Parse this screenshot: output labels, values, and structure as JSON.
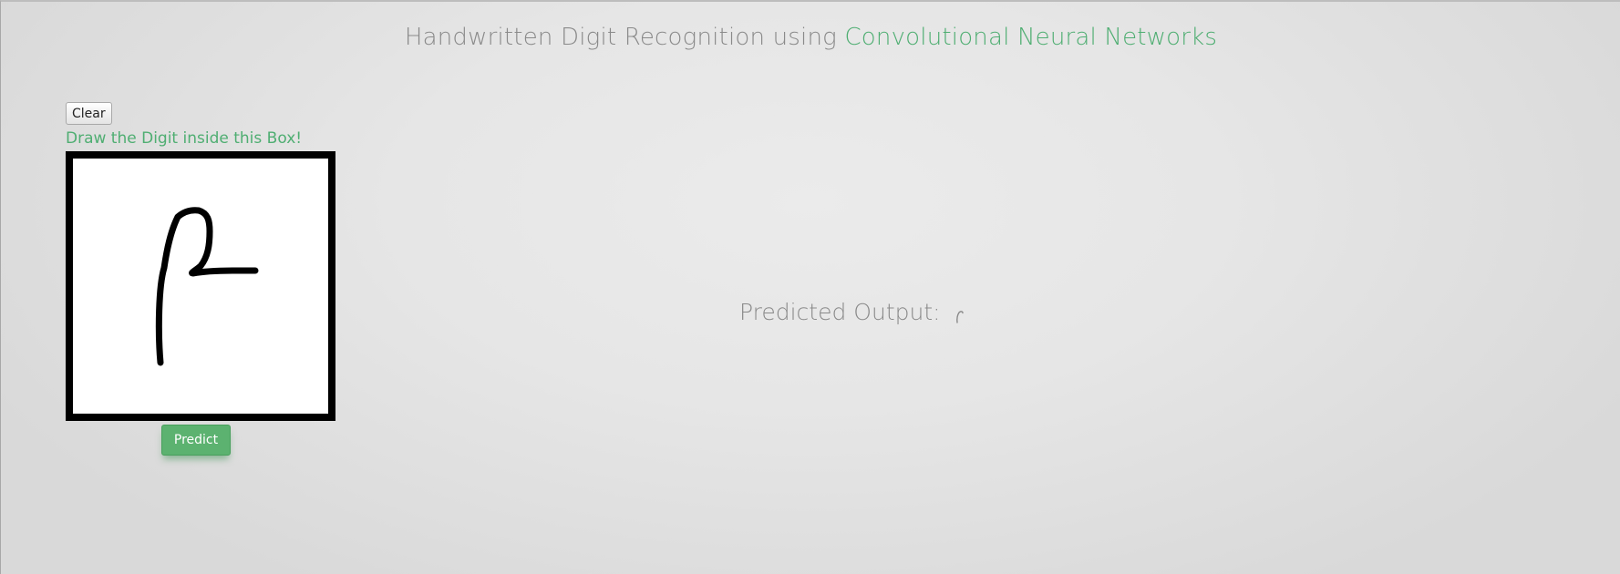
{
  "header": {
    "title_prefix": "Handwritten Digit Recognition using ",
    "title_accent": "Convolutional Neural Networks"
  },
  "controls": {
    "clear_label": "Clear",
    "instruction": "Draw the Digit inside this Box!",
    "predict_label": "Predict"
  },
  "output": {
    "label": "Predicted Output:",
    "value_icon": "small-handwritten-glyph"
  },
  "colors": {
    "accent": "#4fae72",
    "predict_button": "#5cb270",
    "text_muted": "#8a8a8a",
    "canvas_border": "#000000"
  }
}
